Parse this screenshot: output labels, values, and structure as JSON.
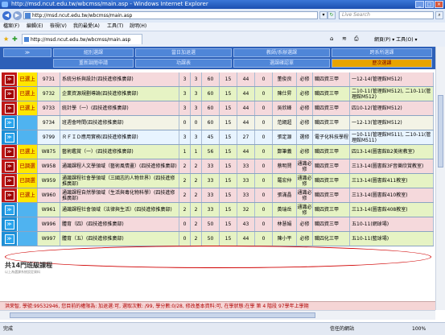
{
  "window": {
    "title": "http://msd.ncut.edu.tw/wbcmss/main.asp - Windows Internet Explorer"
  },
  "address": {
    "url": "http://msd.ncut.edu.tw/wbcmss/main.asp",
    "search_placeholder": "Live Search"
  },
  "menu": [
    "檔案(F)",
    "編輯(E)",
    "檢視(V)",
    "我的最愛(A)",
    "工具(T)",
    "說明(H)"
  ],
  "tab": {
    "label": "http://msd.ncut.edu.tw/wbcmss/main.asp",
    "tools": "網頁(P) ▾   工具(O) ▾"
  },
  "nav": {
    "row1": [
      "≫",
      "組別選課",
      "當日加退選",
      "教師/系辦選課",
      "跨系所選課"
    ],
    "row2": [
      "重新調閱申請",
      "功課表",
      "選課確認單",
      "歷次選課"
    ]
  },
  "rows": [
    {
      "sel": "≫",
      "status": "已選上",
      "code": "9731",
      "name": "系統分析與設計(四技進修推廣部)",
      "c1": "3",
      "c2": "3",
      "c3": "60",
      "c4": "15",
      "c5": "44",
      "c6": "0",
      "teacher": "董俊良",
      "type": "必修",
      "dept": "職四資三甲",
      "time": "一12-14(管理館M512)"
    },
    {
      "sel": "≫",
      "status": "已選上",
      "code": "9732",
      "name": "企業資源規劃導論(四技進修推廣部)",
      "c1": "3",
      "c2": "3",
      "c3": "60",
      "c4": "15",
      "c5": "44",
      "c6": "0",
      "teacher": "陳仕昇",
      "type": "必修",
      "dept": "職四資三甲",
      "time": "二10-11(管理館M512), 二10-11(管理館M512)"
    },
    {
      "sel": "≫",
      "status": "已選上",
      "code": "9733",
      "name": "統計學（一）(四技進修推廣部)",
      "c1": "3",
      "c2": "3",
      "c3": "60",
      "c4": "15",
      "c5": "44",
      "c6": "0",
      "teacher": "吳欣峰",
      "type": "必修",
      "dept": "職四資三甲",
      "time": "四10-12(管理館M512)"
    },
    {
      "sel": "≫",
      "status": "",
      "code": "9734",
      "name": "班週會時間(四技進修推廣部)",
      "c1": "0",
      "c2": "0",
      "c3": "60",
      "c4": "15",
      "c5": "44",
      "c6": "0",
      "teacher": "范綱超",
      "type": "必修",
      "dept": "職四資三甲",
      "time": "一12-13(管理館M512)"
    },
    {
      "sel": "≫",
      "status": "",
      "code": "9799",
      "name": "ＲＦＩＤ應用實務(四技進修推廣部)",
      "c1": "3",
      "c2": "3",
      "c3": "45",
      "c4": "15",
      "c5": "27",
      "c6": "0",
      "teacher": "張定源",
      "type": "選修",
      "dept": "電子化科技學程",
      "time": "一10-11(管理館M511), 二10-11(管理館M511)"
    },
    {
      "sel": "≫",
      "status": "已選上",
      "code": "W875",
      "name": "藝術鑑賞（一）(四技進修推廣部)",
      "c1": "1",
      "c2": "1",
      "c3": "56",
      "c4": "15",
      "c5": "44",
      "c6": "0",
      "teacher": "鄭筆義",
      "type": "必修",
      "dept": "職四資三甲",
      "time": "四13-14(圖書館B2美術教室)"
    },
    {
      "sel": "≫",
      "status": "已調選",
      "code": "W958",
      "name": "通識課程人文學領域（藝術風情畫）(四技進修推廣部)",
      "c1": "2",
      "c2": "2",
      "c3": "33",
      "c4": "15",
      "c5": "33",
      "c6": "0",
      "teacher": "蔡明賢",
      "type": "通識必修",
      "dept": "職四資三甲",
      "time": "三13-14(圖書館3F音樂欣賞教室)"
    },
    {
      "sel": "≫",
      "status": "已調選",
      "code": "W959",
      "name": "通識課程社會學領域（三國志的人物世界）(四技進修推廣部)",
      "c1": "2",
      "c2": "2",
      "c3": "33",
      "c4": "15",
      "c5": "33",
      "c6": "0",
      "teacher": "羅宏仲",
      "type": "通識必修",
      "dept": "職四資三甲",
      "time": "三13-14(圖書館411教室)"
    },
    {
      "sel": "≫",
      "status": "已選上",
      "code": "W960",
      "name": "通識課程自然學領域（生活與毒化物科學）(四技進修推廣部)",
      "c1": "2",
      "c2": "2",
      "c3": "33",
      "c4": "15",
      "c5": "33",
      "c6": "0",
      "teacher": "張滿晶",
      "type": "通識必修",
      "dept": "職四資三甲",
      "time": "三13-14(圖書館410教室)"
    },
    {
      "sel": "≫",
      "status": "",
      "code": "W961",
      "name": "通識課程社會領域（法律與生活）(四技進修推廣部)",
      "c1": "2",
      "c2": "2",
      "c3": "33",
      "c4": "15",
      "c5": "32",
      "c6": "0",
      "teacher": "黃瑞岳",
      "type": "通識必修",
      "dept": "職四資三甲",
      "time": "三13-14(圖書館408教室)"
    },
    {
      "sel": "≫",
      "status": "",
      "code": "W996",
      "name": "體育（四）(四技進修推廣部)",
      "c1": "0",
      "c2": "2",
      "c3": "50",
      "c4": "15",
      "c5": "43",
      "c6": "0",
      "teacher": "林慧娟",
      "type": "必修",
      "dept": "職四資三甲",
      "time": "五10-11(網球場)"
    },
    {
      "sel": "≫",
      "status": "",
      "code": "W997",
      "name": "體育（五）(四技進修推廣部)",
      "c1": "0",
      "c2": "2",
      "c3": "50",
      "c4": "15",
      "c5": "44",
      "c6": "0",
      "teacher": "陳小平",
      "type": "必修",
      "dept": "職四化三甲",
      "time": "五10-11(籃球場)"
    }
  ],
  "total": "共14門班級課程",
  "total_note": "以上為選課系統設定資料",
  "bottom": "洪荣智, 學號:99532946, 您目前的權限為: 加退選:可, 選取次數: /99, 學分數:0/28, 修改基本資料:可, 在學狀態:在學 第 4 階段 97學年上學期",
  "status": {
    "done": "完成",
    "zone": "信任的網站",
    "zoom": "100%"
  }
}
